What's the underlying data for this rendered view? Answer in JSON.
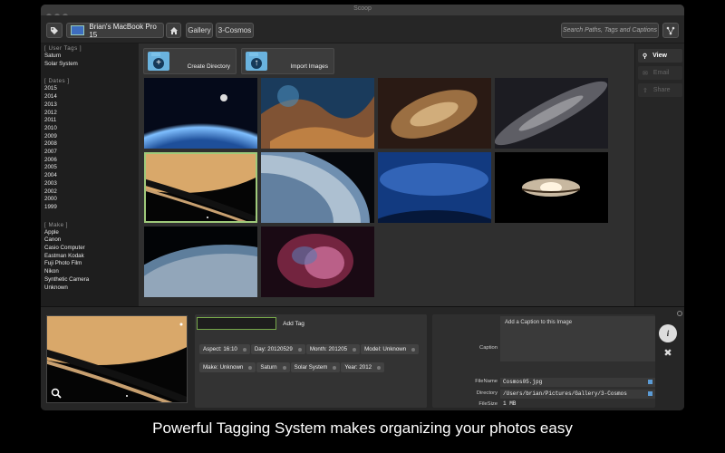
{
  "window": {
    "title": "Scoop"
  },
  "toolbar": {
    "location": "Brian's MacBook Pro 15",
    "breadcrumbs": [
      "Gallery",
      "3-Cosmos"
    ],
    "search_placeholder": "Search Paths, Tags and Captions"
  },
  "sidebar": {
    "user_tags": {
      "header": "[ User Tags ]",
      "items": [
        "Saturn",
        "Solar System"
      ]
    },
    "dates": {
      "header": "[ Dates ]",
      "items": [
        "2015",
        "2014",
        "2013",
        "2012",
        "2011",
        "2010",
        "2009",
        "2008",
        "2007",
        "2006",
        "2005",
        "2004",
        "2003",
        "2002",
        "2000",
        "1999"
      ]
    },
    "make": {
      "header": "[ Make ]",
      "items": [
        "Apple",
        "Canon",
        "Casio Computer",
        "Eastman Kodak",
        "Fuji Photo Film",
        "Nikon",
        "Synthetic Camera",
        "Unknown"
      ]
    }
  },
  "actions": {
    "create": "Create Directory",
    "import": "Import Images"
  },
  "right_panel": {
    "view": "View",
    "email": "Email",
    "share": "Share"
  },
  "tagging": {
    "add_tag": "Add Tag",
    "tags": [
      "Aspect: 16:10",
      "Day: 20120529",
      "Month: 201205",
      "Model: Unknown",
      "Make: Unknown",
      "Saturn",
      "Solar System",
      "Year: 2012"
    ]
  },
  "metadata": {
    "caption_label": "Caption",
    "caption_placeholder": "Add a Caption to this Image",
    "filename_label": "FileName",
    "filename": "Cosmos05.jpg",
    "directory_label": "Directory",
    "directory": "/Users/brian/Pictures/Gallery/3-Cosmos",
    "filesize_label": "FileSize",
    "filesize": "1 MB"
  },
  "colors": {
    "selection": "#9fc97a",
    "folder": "#6ab3df"
  },
  "promo_caption": "Powerful Tagging System makes organizing your photos easy"
}
